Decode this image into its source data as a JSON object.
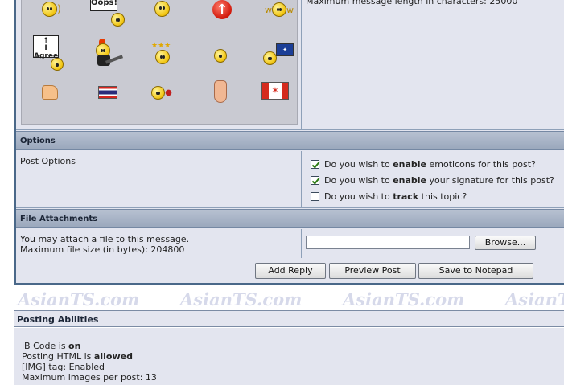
{
  "watermark": "AsianTS.com",
  "max_message_length_text": "Maximum message length in characters: 25000",
  "emoticons": [
    {
      "icon": "listening-smiley-icon"
    },
    {
      "icon": "oops-sign-smiley-icon",
      "sign_text": "Oops!"
    },
    {
      "icon": "shocked-smiley-icon"
    },
    {
      "icon": "red-up-arrow-icon"
    },
    {
      "icon": "waving-smiley-icon"
    },
    {
      "icon": "i-agree-sign-smiley-icon",
      "sign_text": "I Agree"
    },
    {
      "icon": "rocker-guitar-smiley-icon"
    },
    {
      "icon": "dizzy-stars-smiley-icon"
    },
    {
      "icon": "thinking-smiley-icon"
    },
    {
      "icon": "australia-flag-smiley-icon"
    },
    {
      "icon": "thumbs-up-icon"
    },
    {
      "icon": "thailand-flag-icon"
    },
    {
      "icon": "pacifier-smiley-icon"
    },
    {
      "icon": "nose-icon"
    },
    {
      "icon": "canada-flag-icon"
    }
  ],
  "options": {
    "header": "Options",
    "label": "Post Options",
    "items": [
      {
        "pre": "Do you wish to ",
        "bold": "enable",
        "post": " emoticons for this post?",
        "checked": true
      },
      {
        "pre": "Do you wish to ",
        "bold": "enable",
        "post": " your signature for this post?",
        "checked": true
      },
      {
        "pre": "Do you wish to ",
        "bold": "track",
        "post": " this topic?",
        "checked": false
      }
    ]
  },
  "attachments": {
    "header": "File Attachments",
    "line1": "You may attach a file to this message.",
    "line2": "Maximum file size (in bytes): 204800",
    "browse_label": "Browse..."
  },
  "buttons": {
    "add_reply": "Add Reply",
    "preview_post": "Preview Post",
    "save_notepad": "Save to Notepad"
  },
  "posting_abilities": {
    "header": "Posting Abilities",
    "ibcode_pre": "iB Code is ",
    "ibcode_val": "on",
    "html_pre": "Posting HTML is ",
    "html_val": "allowed",
    "img_tag": "[IMG] tag: Enabled",
    "max_images": "Maximum images per post: 13"
  }
}
